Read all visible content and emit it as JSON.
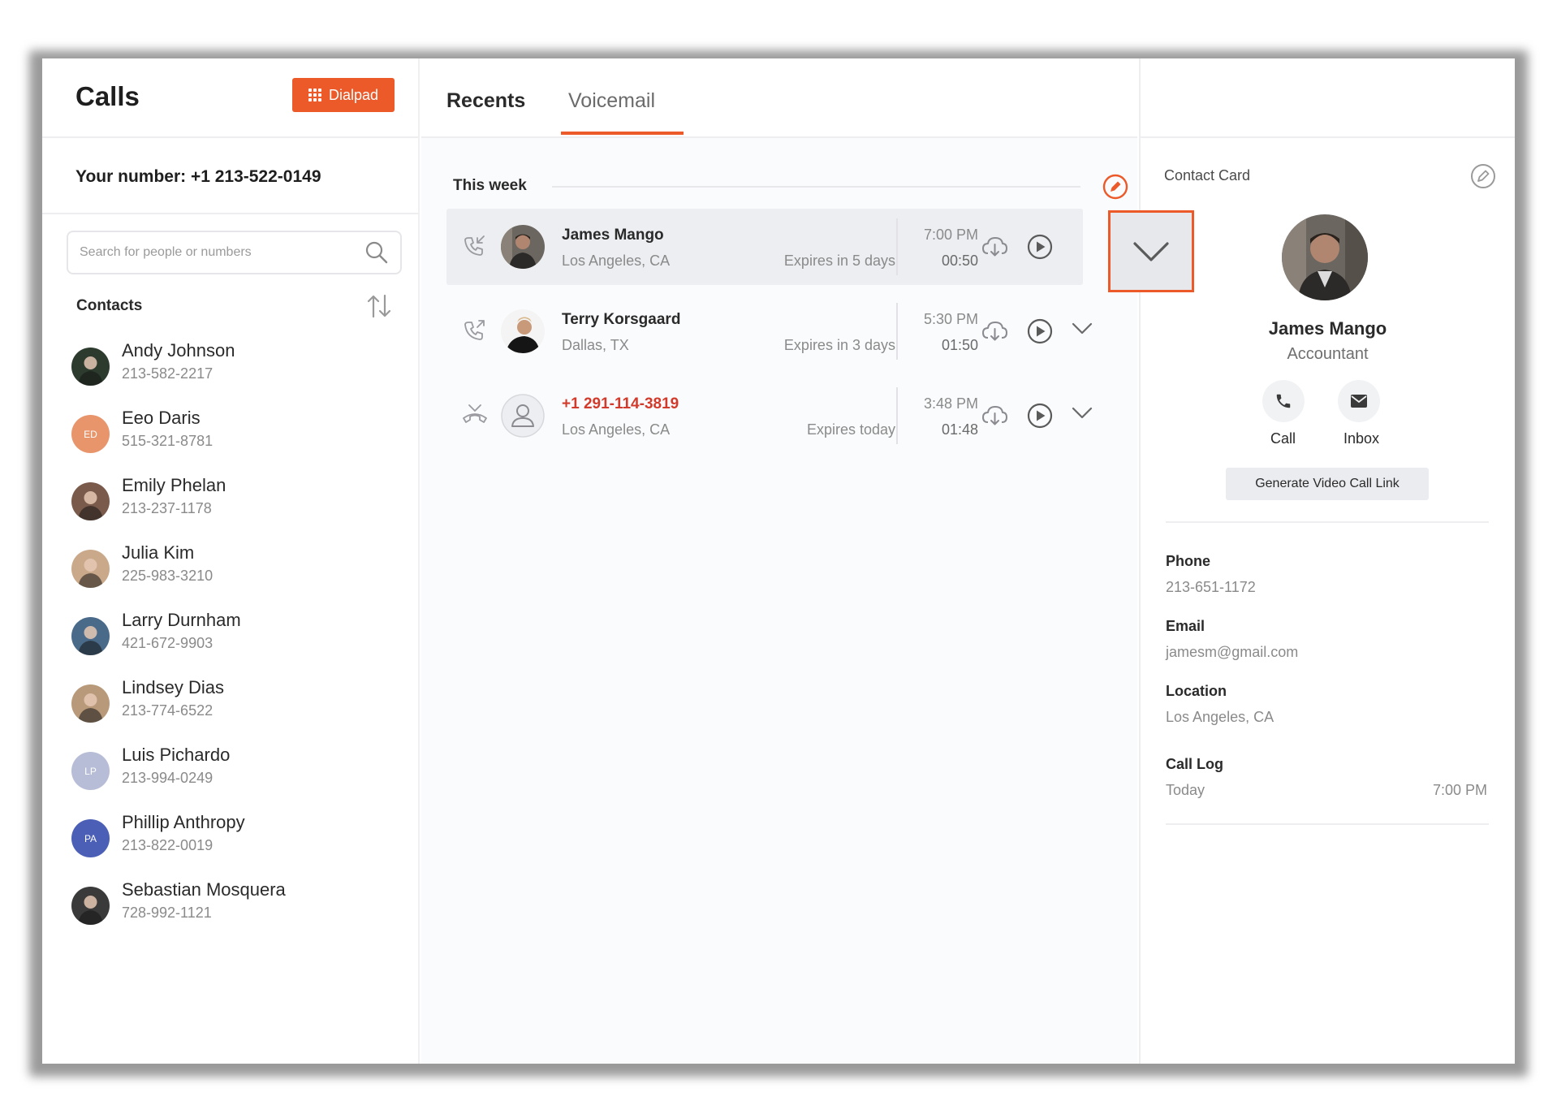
{
  "app": {
    "title": "Calls",
    "dialpad_label": "Dialpad"
  },
  "your_number": "Your number: +1 213-522-0149",
  "search": {
    "placeholder": "Search for people or numbers"
  },
  "contacts_label": "Contacts",
  "contacts": [
    {
      "name": "Andy Johnson",
      "phone": "213-582-2217",
      "initials": "",
      "color": "#2d3a2e"
    },
    {
      "name": "Eeo Daris",
      "phone": "515-321-8781",
      "initials": "ED",
      "color": "#e8956c"
    },
    {
      "name": "Emily Phelan",
      "phone": "213-237-1178",
      "initials": "",
      "color": "#7a5a4a"
    },
    {
      "name": "Julia Kim",
      "phone": "225-983-3210",
      "initials": "",
      "color": "#c9a98a"
    },
    {
      "name": "Larry Durnham",
      "phone": "421-672-9903",
      "initials": "",
      "color": "#4a6a8a"
    },
    {
      "name": "Lindsey Dias",
      "phone": "213-774-6522",
      "initials": "",
      "color": "#b89a7a"
    },
    {
      "name": "Luis Pichardo",
      "phone": "213-994-0249",
      "initials": "LP",
      "color": "#b7bdd6"
    },
    {
      "name": "Phillip Anthropy",
      "phone": "213-822-0019",
      "initials": "PA",
      "color": "#4a5fb5"
    },
    {
      "name": "Sebastian Mosquera",
      "phone": "728-992-1121",
      "initials": "",
      "color": "#3a3a3a"
    }
  ],
  "tabs": [
    {
      "label": "Recents"
    },
    {
      "label": "Voicemail"
    }
  ],
  "section_label": "This week",
  "voicemails": [
    {
      "name": "James Mango",
      "location": "Los Angeles, CA",
      "expires": "Expires in 5 days",
      "time": "7:00 PM",
      "duration": "00:50",
      "unknown": false
    },
    {
      "name": "Terry Korsgaard",
      "location": "Dallas, TX",
      "expires": "Expires in 3 days",
      "time": "5:30 PM",
      "duration": "01:50",
      "unknown": false
    },
    {
      "name": "+1 291-114-3819",
      "location": "Los Angeles, CA",
      "expires": "Expires today",
      "time": "3:48 PM",
      "duration": "01:48",
      "unknown": true
    }
  ],
  "contact_card": {
    "label": "Contact Card",
    "name": "James Mango",
    "role": "Accountant",
    "call_label": "Call",
    "inbox_label": "Inbox",
    "generate_label": "Generate Video Call Link",
    "phone_label": "Phone",
    "phone": "213-651-1172",
    "email_label": "Email",
    "email": "jamesm@gmail.com",
    "location_label": "Location",
    "location": "Los Angeles, CA",
    "call_log_label": "Call Log",
    "call_log_day": "Today",
    "call_log_time": "7:00 PM"
  },
  "colors": {
    "accent": "#ec5a2a",
    "missed": "#d23b2b"
  }
}
